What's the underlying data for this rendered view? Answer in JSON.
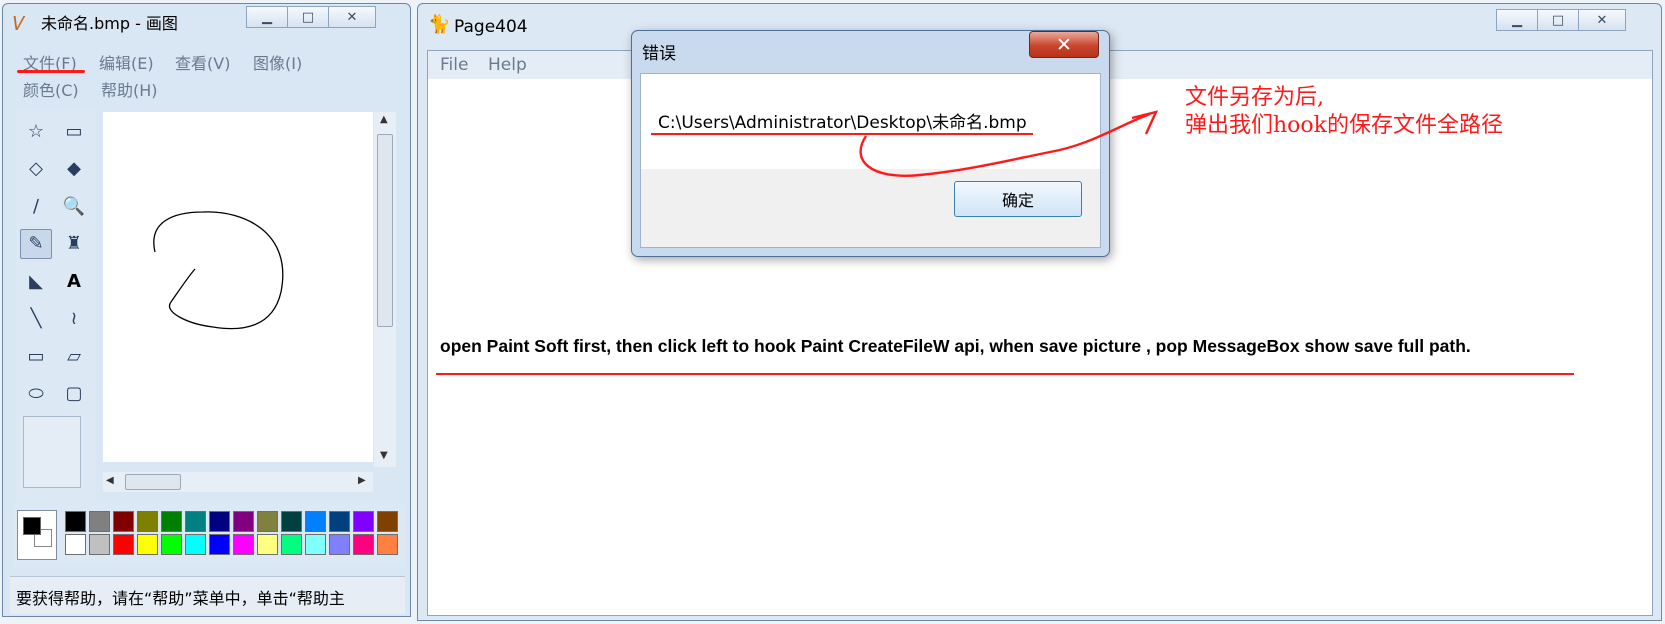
{
  "paint": {
    "title": "未命名.bmp - 画图",
    "menu": [
      {
        "label": "文件(F)"
      },
      {
        "label": "编辑(E)"
      },
      {
        "label": "查看(V)"
      },
      {
        "label": "图像(I)"
      },
      {
        "label": "颜色(C)"
      },
      {
        "label": "帮助(H)"
      }
    ],
    "tools": [
      {
        "name": "free-form-select-tool",
        "glyph": "☆"
      },
      {
        "name": "rect-select-tool",
        "glyph": "▭"
      },
      {
        "name": "eraser-tool",
        "glyph": "◇"
      },
      {
        "name": "fill-tool",
        "glyph": "◆"
      },
      {
        "name": "color-picker-tool",
        "glyph": "∕"
      },
      {
        "name": "magnifier-tool",
        "glyph": "🔍"
      },
      {
        "name": "pencil-tool",
        "glyph": "✎"
      },
      {
        "name": "brush-tool",
        "glyph": "♜"
      },
      {
        "name": "airbrush-tool",
        "glyph": "◣"
      },
      {
        "name": "text-tool",
        "glyph": "A"
      },
      {
        "name": "line-tool",
        "glyph": "╲"
      },
      {
        "name": "curve-tool",
        "glyph": "≀"
      },
      {
        "name": "rectangle-tool",
        "glyph": "▭"
      },
      {
        "name": "polygon-tool",
        "glyph": "▱"
      },
      {
        "name": "ellipse-tool",
        "glyph": "⬭"
      },
      {
        "name": "rounded-rect-tool",
        "glyph": "▢"
      }
    ],
    "palette_top": [
      "#000000",
      "#808080",
      "#800000",
      "#808000",
      "#008000",
      "#008080",
      "#000080",
      "#800080",
      "#808040",
      "#004040",
      "#0080ff",
      "#004080",
      "#8000ff",
      "#804000"
    ],
    "palette_bottom": [
      "#ffffff",
      "#c0c0c0",
      "#ff0000",
      "#ffff00",
      "#00ff00",
      "#00ffff",
      "#0000ff",
      "#ff00ff",
      "#ffff80",
      "#00ff80",
      "#80ffff",
      "#8080ff",
      "#ff0080",
      "#ff8040"
    ],
    "foreground_color": "#000000",
    "background_color": "#ffffff",
    "status": "要获得帮助，请在“帮助”菜单中，单击“帮助主"
  },
  "page404": {
    "title": "Page404",
    "menu": [
      {
        "label": "File"
      },
      {
        "label": "Help"
      }
    ],
    "instruction": "open Paint Soft first, then click left to hook Paint CreateFileW api, when save picture , pop MessageBox show save full path."
  },
  "dialog": {
    "title": "错误",
    "message": "C:\\Users\\Administrator\\Desktop\\未命名.bmp",
    "ok_label": "确定"
  },
  "annotation": {
    "line1": "文件另存为后,",
    "line2": "弹出我们hook的保存文件全路径",
    "color": "#ff1a1a"
  }
}
